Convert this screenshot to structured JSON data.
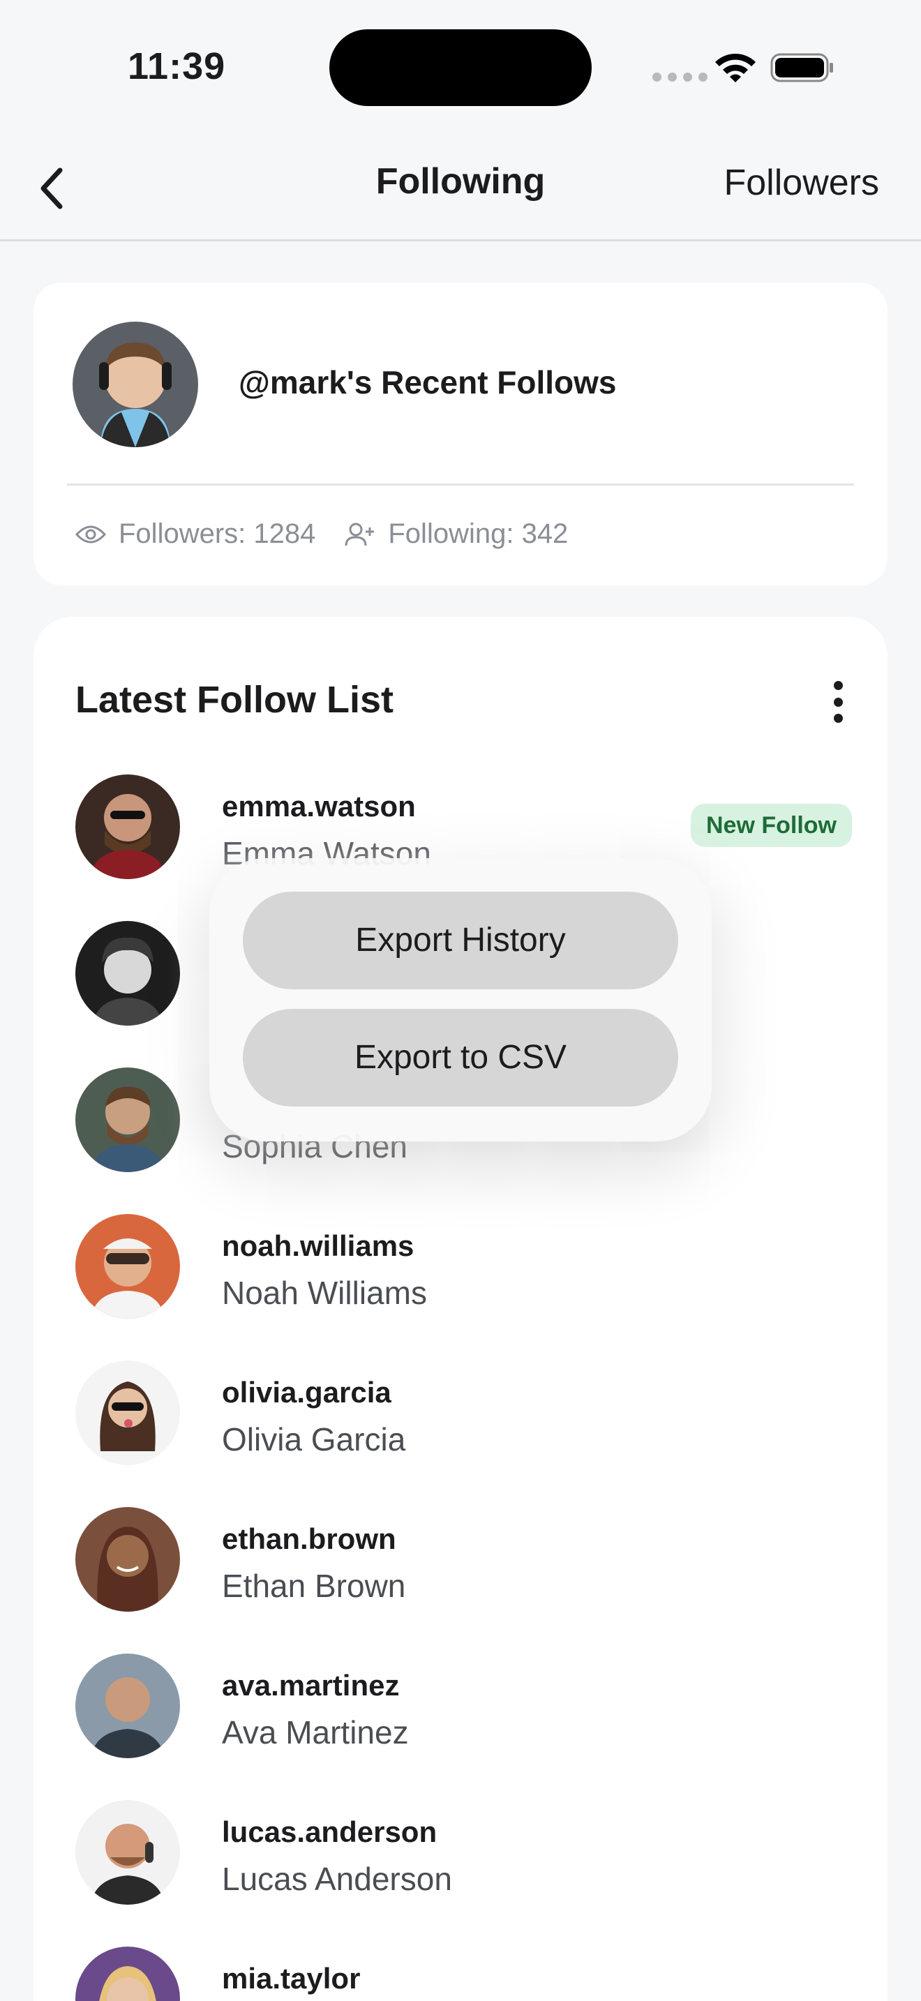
{
  "status_bar": {
    "time": "11:39"
  },
  "nav": {
    "title": "Following",
    "right_link": "Followers"
  },
  "profile": {
    "title": "@mark's Recent Follows",
    "followers": "Followers: 1284",
    "following": "Following: 342"
  },
  "list": {
    "title": "Latest Follow List",
    "badge": "New Follow",
    "rows": [
      {
        "handle": "emma.watson",
        "name": "Emma Watson"
      },
      {
        "handle": "",
        "name": ""
      },
      {
        "handle": "",
        "name": "Sophia Chen"
      },
      {
        "handle": "noah.williams",
        "name": "Noah Williams"
      },
      {
        "handle": "olivia.garcia",
        "name": "Olivia Garcia"
      },
      {
        "handle": "ethan.brown",
        "name": "Ethan Brown"
      },
      {
        "handle": "ava.martinez",
        "name": "Ava Martinez"
      },
      {
        "handle": "lucas.anderson",
        "name": "Lucas Anderson"
      },
      {
        "handle": "mia.taylor",
        "name": ""
      }
    ]
  },
  "menu": {
    "export_history": "Export History",
    "export_csv": "Export to CSV"
  },
  "colors": {
    "accent_badge_bg": "#d7f2e0",
    "accent_badge_text": "#1e6b37",
    "background": "#f6f7f9"
  },
  "icons": [
    "back-chevron-icon",
    "eye-icon",
    "add-user-icon",
    "more-vertical-icon",
    "wifi-icon",
    "battery-icon",
    "signal-icon"
  ]
}
